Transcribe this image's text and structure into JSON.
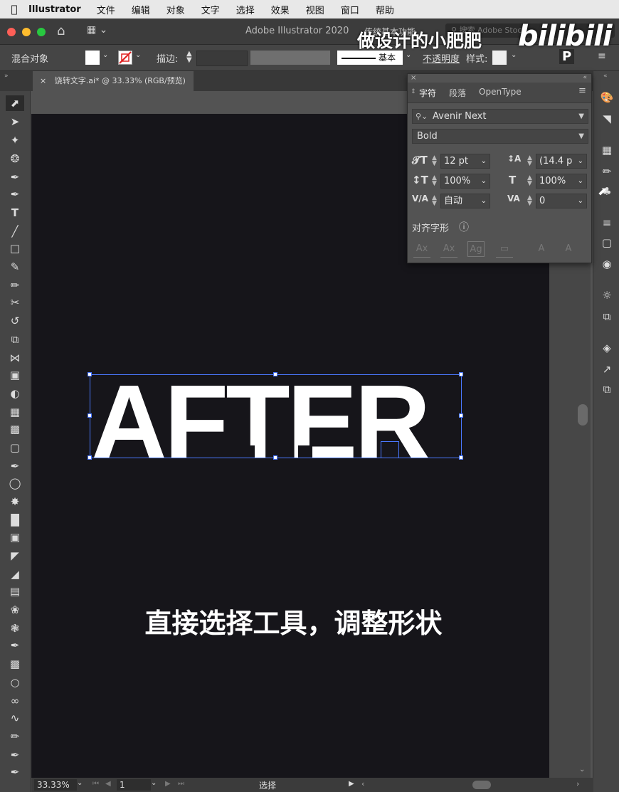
{
  "menubar": {
    "app": "Illustrator",
    "items": [
      "文件",
      "编辑",
      "对象",
      "文字",
      "选择",
      "效果",
      "视图",
      "窗口",
      "帮助"
    ]
  },
  "titlebar": {
    "title": "Adobe Illustrator 2020",
    "workspace": "传统基本功能",
    "search_placeholder": "搜索 Adobe Stock"
  },
  "controlbar": {
    "selection_label": "混合对象",
    "stroke_label": "描边:",
    "stroke_style": "基本",
    "opacity_label": "不透明度",
    "style_label": "样式:"
  },
  "document_tab": {
    "label": "饶转文字.ai* @ 33.33% (RGB/预览)"
  },
  "character_panel": {
    "tabs": [
      "字符",
      "段落",
      "OpenType"
    ],
    "font_family": "Avenir Next",
    "font_style": "Bold",
    "font_size": "12 pt",
    "leading": "(14.4 p",
    "vertical_scale": "100%",
    "horizontal_scale": "100%",
    "kerning": "自动",
    "tracking": "0",
    "snap_label": "对齐字形"
  },
  "canvas": {
    "artwork_text": "AFTER",
    "subtitle": "直接选择工具，调整形状"
  },
  "watermark": {
    "text": "做设计的小肥肥",
    "logo": "bilibili"
  },
  "statusbar": {
    "zoom": "33.33%",
    "artboard": "1",
    "tool": "选择"
  },
  "colors": {
    "selection": "#4a78ff",
    "artboard": "#16151a",
    "panel": "#535353"
  }
}
